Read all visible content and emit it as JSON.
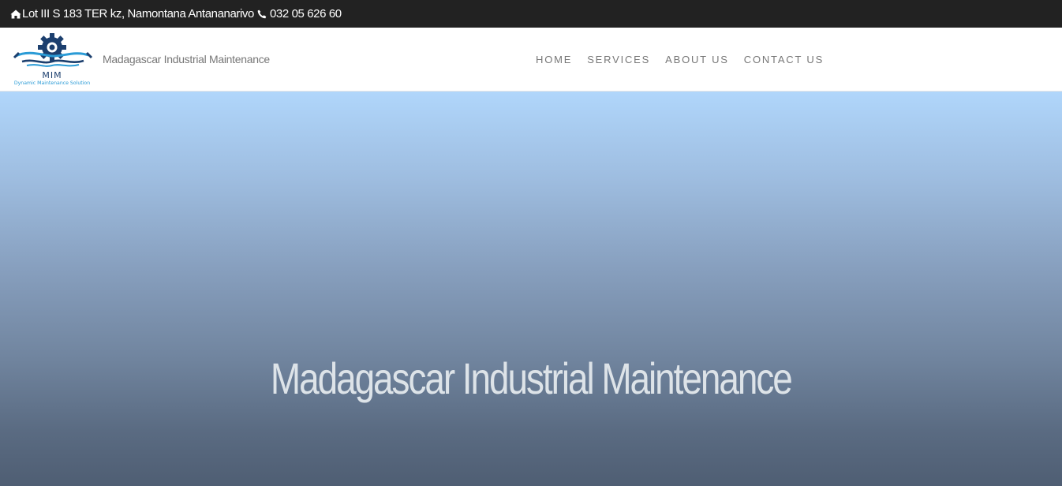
{
  "topbar": {
    "address_icon": "home-icon",
    "address": "Lot III S 183 TER kz, Namontana Antananarivo",
    "phone_icon": "phone-icon",
    "phone": "032 05 626 60"
  },
  "header": {
    "logo": {
      "icon": "gear-wrench-logo-icon",
      "initials": "MIM",
      "tagline": "Dynamic Maintenance Solution",
      "colors": {
        "primary": "#1c3f6e",
        "accent": "#2a9bd6"
      }
    },
    "brand": "Madagascar Industrial Maintenance"
  },
  "nav": {
    "items": [
      {
        "label": "HOME"
      },
      {
        "label": "SERVICES"
      },
      {
        "label": "ABOUT US"
      },
      {
        "label": "CONTACT US"
      }
    ]
  },
  "hero": {
    "title": "Madagascar Industrial Maintenance",
    "colors": {
      "top": "#b0d6fb",
      "bottom": "#4f5e73",
      "text": "#dde3e8"
    }
  }
}
